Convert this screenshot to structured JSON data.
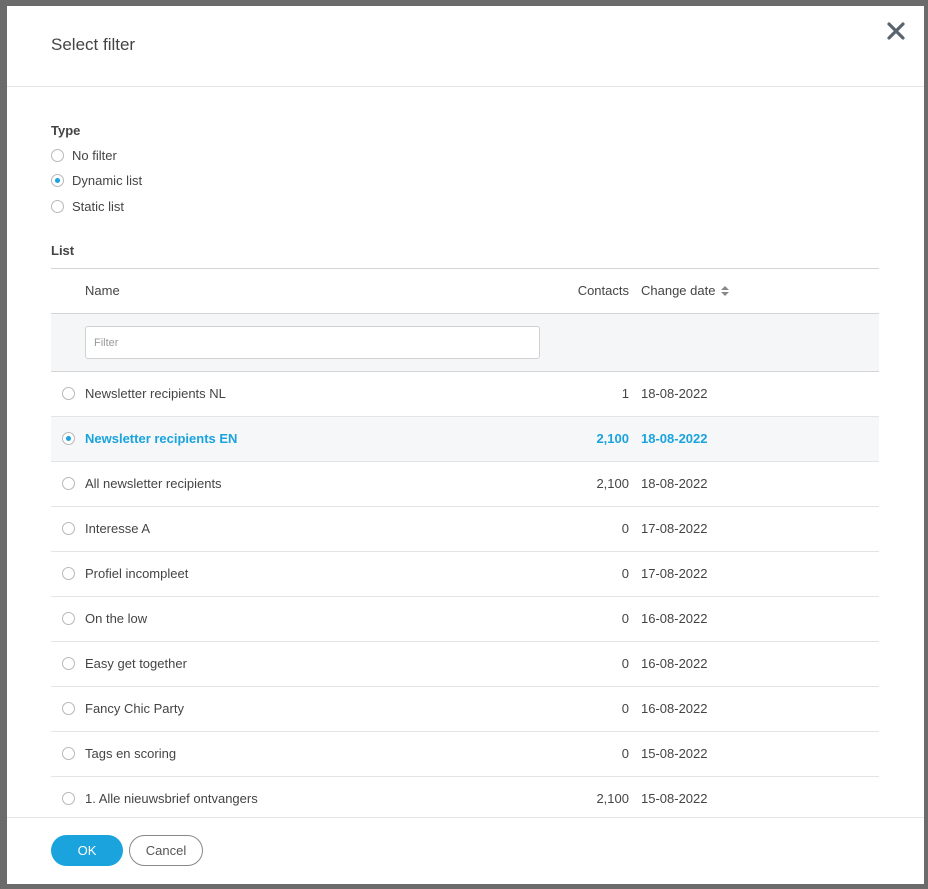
{
  "dialog": {
    "title": "Select filter"
  },
  "type_section": {
    "label": "Type",
    "options": [
      {
        "label": "No filter",
        "checked": false
      },
      {
        "label": "Dynamic list",
        "checked": true
      },
      {
        "label": "Static list",
        "checked": false
      }
    ]
  },
  "list_section": {
    "label": "List",
    "columns": {
      "name": "Name",
      "contacts": "Contacts",
      "change_date": "Change date"
    },
    "filter_placeholder": "Filter",
    "rows": [
      {
        "name": "Newsletter recipients NL",
        "contacts": "1",
        "date": "18-08-2022",
        "selected": false
      },
      {
        "name": "Newsletter recipients EN",
        "contacts": "2,100",
        "date": "18-08-2022",
        "selected": true
      },
      {
        "name": "All newsletter recipients",
        "contacts": "2,100",
        "date": "18-08-2022",
        "selected": false
      },
      {
        "name": "Interesse A",
        "contacts": "0",
        "date": "17-08-2022",
        "selected": false
      },
      {
        "name": "Profiel incompleet",
        "contacts": "0",
        "date": "17-08-2022",
        "selected": false
      },
      {
        "name": "On the low",
        "contacts": "0",
        "date": "16-08-2022",
        "selected": false
      },
      {
        "name": "Easy get together",
        "contacts": "0",
        "date": "16-08-2022",
        "selected": false
      },
      {
        "name": "Fancy Chic Party",
        "contacts": "0",
        "date": "16-08-2022",
        "selected": false
      },
      {
        "name": "Tags en scoring",
        "contacts": "0",
        "date": "15-08-2022",
        "selected": false
      },
      {
        "name": "1. Alle nieuwsbrief ontvangers",
        "contacts": "2,100",
        "date": "15-08-2022",
        "selected": false
      }
    ]
  },
  "footer": {
    "ok_label": "OK",
    "cancel_label": "Cancel"
  },
  "colors": {
    "accent": "#1aa3dd",
    "overlay": "#6b6b6b"
  }
}
